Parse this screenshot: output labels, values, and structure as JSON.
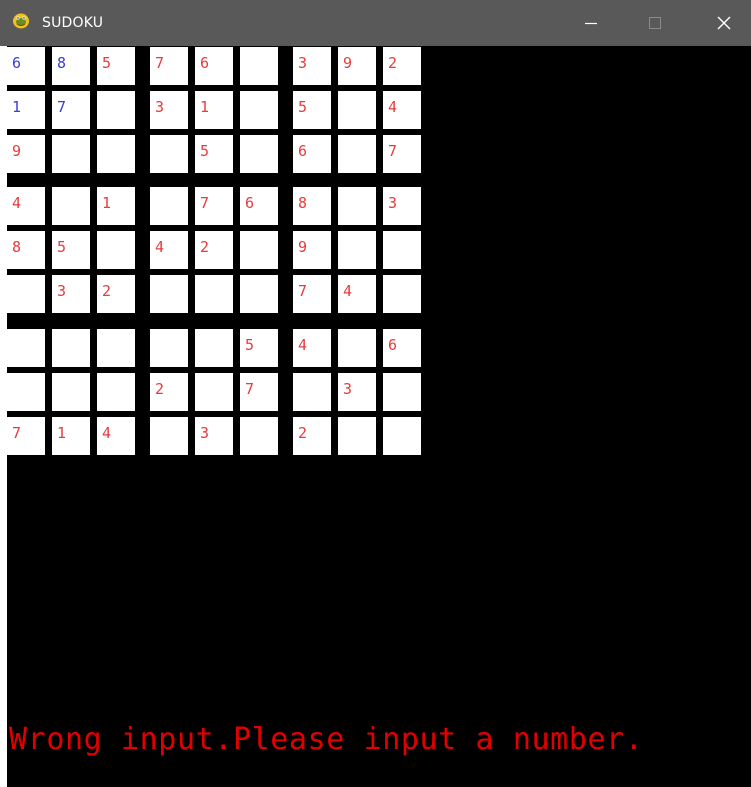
{
  "window": {
    "title": "SUDOKU"
  },
  "colors": {
    "given": "#3b3bd6",
    "entered": "#e83b3b",
    "status": "#e00000",
    "cell_bg": "#ffffff",
    "board_bg": "#000000"
  },
  "board": {
    "rows": [
      [
        "6",
        "8",
        "5",
        "7",
        "6",
        "",
        "3",
        "9",
        "2"
      ],
      [
        "1",
        "7",
        "",
        "3",
        "1",
        "",
        "5",
        "",
        "4"
      ],
      [
        "9",
        "",
        "",
        "",
        "5",
        "",
        "6",
        "",
        "7"
      ],
      [
        "4",
        "",
        "1",
        "",
        "7",
        "6",
        "8",
        "",
        "3"
      ],
      [
        "8",
        "5",
        "",
        "4",
        "2",
        "",
        "9",
        "",
        ""
      ],
      [
        "",
        "3",
        "2",
        "",
        "",
        "",
        "7",
        "4",
        ""
      ],
      [
        "",
        "",
        "",
        "",
        "",
        "5",
        "4",
        "",
        "6"
      ],
      [
        "",
        "",
        "",
        "2",
        "",
        "7",
        "",
        "3",
        ""
      ],
      [
        "7",
        "1",
        "4",
        "",
        "3",
        "",
        "2",
        "",
        ""
      ]
    ],
    "blue_cells": [
      [
        0,
        0
      ],
      [
        0,
        1
      ],
      [
        1,
        0
      ],
      [
        1,
        1
      ]
    ]
  },
  "status_message": "Wrong input.Please input a number."
}
